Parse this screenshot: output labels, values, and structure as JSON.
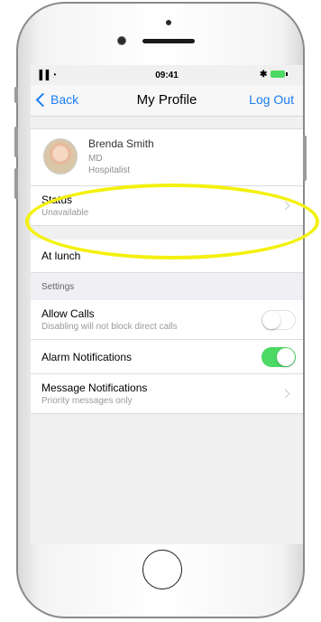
{
  "status_bar": {
    "signal": "▐▐ ◔",
    "time": "09:41",
    "bluetooth": "✱"
  },
  "nav": {
    "back_label": "Back",
    "title": "My Profile",
    "logout_label": "Log Out"
  },
  "profile": {
    "name": "Brenda Smith",
    "title": "MD",
    "role": "Hospitalist"
  },
  "status_row": {
    "title": "Status",
    "value": "Unavailable"
  },
  "message_row": {
    "text": "At lunch"
  },
  "settings": {
    "header": "Settings",
    "allow_calls": {
      "title": "Allow Calls",
      "subtitle": "Disabling will not block direct calls",
      "enabled": false
    },
    "alarm_notifications": {
      "title": "Alarm Notifications",
      "enabled": true
    },
    "message_notifications": {
      "title": "Message Notifications",
      "subtitle": "Priority messages only"
    }
  },
  "colors": {
    "accent": "#1a7cf3",
    "toggle_on": "#4cd964",
    "highlight": "#f3f10e"
  }
}
